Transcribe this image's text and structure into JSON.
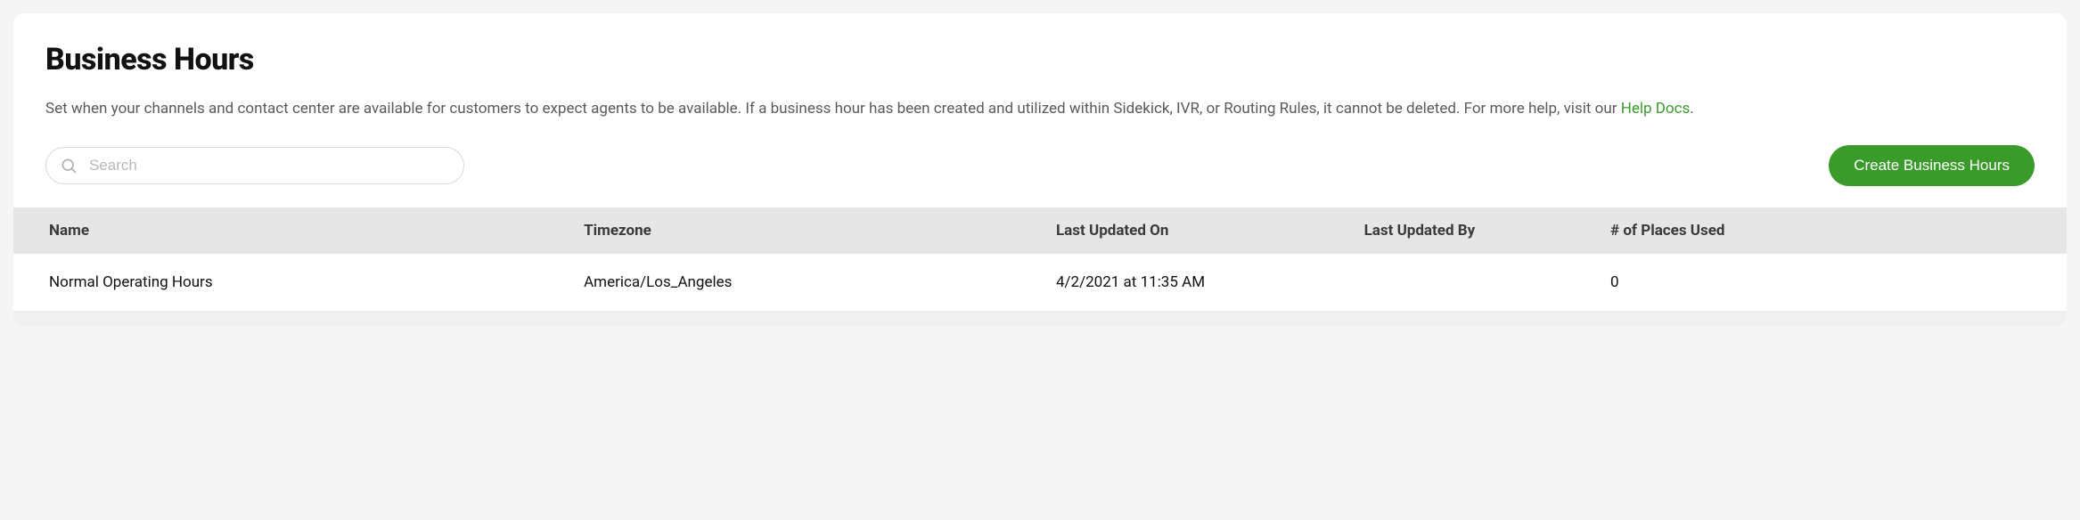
{
  "header": {
    "title": "Business Hours",
    "description_prefix": "Set when your channels and contact center are available for customers to expect agents to be available. If a business hour has been created and utilized within Sidekick, IVR, or Routing Rules, it cannot be deleted. For more help, visit our ",
    "help_link_text": "Help Docs",
    "description_suffix": "."
  },
  "toolbar": {
    "search_placeholder": "Search",
    "create_button_label": "Create Business Hours"
  },
  "table": {
    "columns": {
      "name": "Name",
      "timezone": "Timezone",
      "last_updated_on": "Last Updated On",
      "last_updated_by": "Last Updated By",
      "places_used": "# of Places Used"
    },
    "rows": [
      {
        "name": "Normal Operating Hours",
        "timezone": "America/Los_Angeles",
        "last_updated_on": "4/2/2021 at 11:35 AM",
        "last_updated_by": "",
        "places_used": "0"
      }
    ]
  }
}
